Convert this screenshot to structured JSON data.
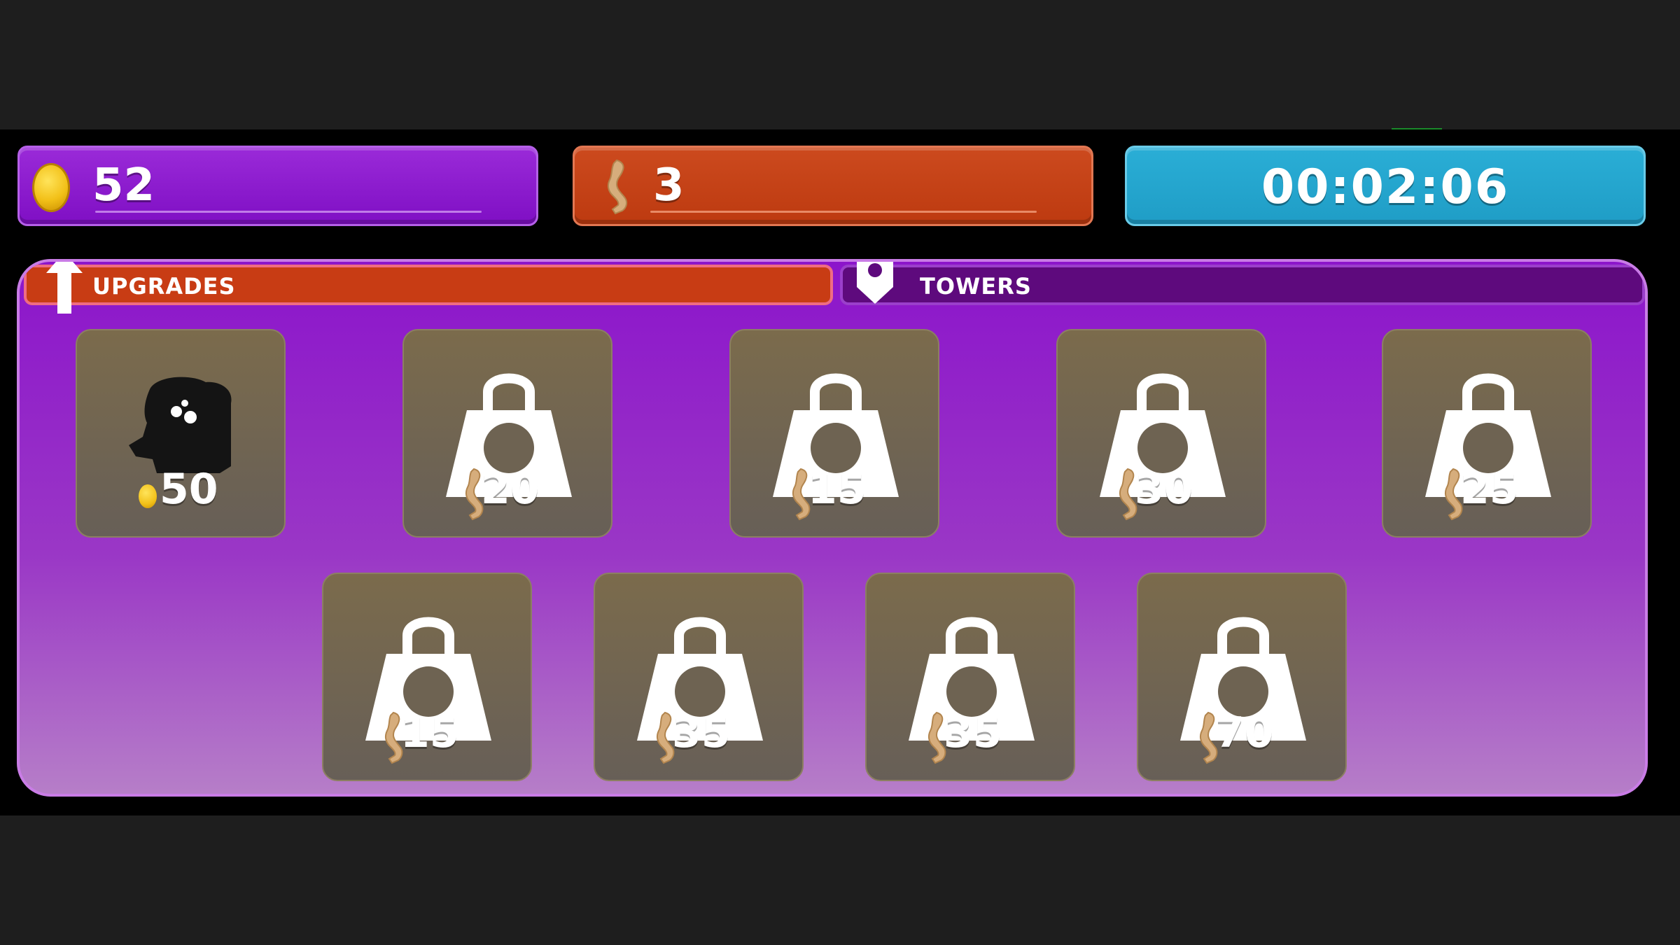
{
  "stats": {
    "coins": "52",
    "legs": "3",
    "timer": "00:02:06"
  },
  "tabs": {
    "upgrades_label": "UPGRADES",
    "towers_label": "TOWERS"
  },
  "slots": [
    {
      "cost": "50",
      "currency": "coin",
      "state": "unlocked",
      "icon": "tower-chest-icon"
    },
    {
      "cost": "20",
      "currency": "leg",
      "state": "locked",
      "icon": "lock-icon"
    },
    {
      "cost": "15",
      "currency": "leg",
      "state": "locked",
      "icon": "lock-icon"
    },
    {
      "cost": "30",
      "currency": "leg",
      "state": "locked",
      "icon": "lock-icon"
    },
    {
      "cost": "25",
      "currency": "leg",
      "state": "locked",
      "icon": "lock-icon"
    },
    {
      "cost": "15",
      "currency": "leg",
      "state": "locked",
      "icon": "lock-icon"
    },
    {
      "cost": "35",
      "currency": "leg",
      "state": "locked",
      "icon": "lock-icon"
    },
    {
      "cost": "35",
      "currency": "leg",
      "state": "locked",
      "icon": "lock-icon"
    },
    {
      "cost": "70",
      "currency": "leg",
      "state": "locked",
      "icon": "lock-icon"
    }
  ],
  "colors": {
    "coin_bar": "#8a1dcf",
    "leg_bar": "#c4401a",
    "timer_bar": "#22a4cc",
    "panel": "#8c15cb",
    "upgrades_tab": "#c83c14",
    "towers_tab": "#5e0a7d"
  }
}
